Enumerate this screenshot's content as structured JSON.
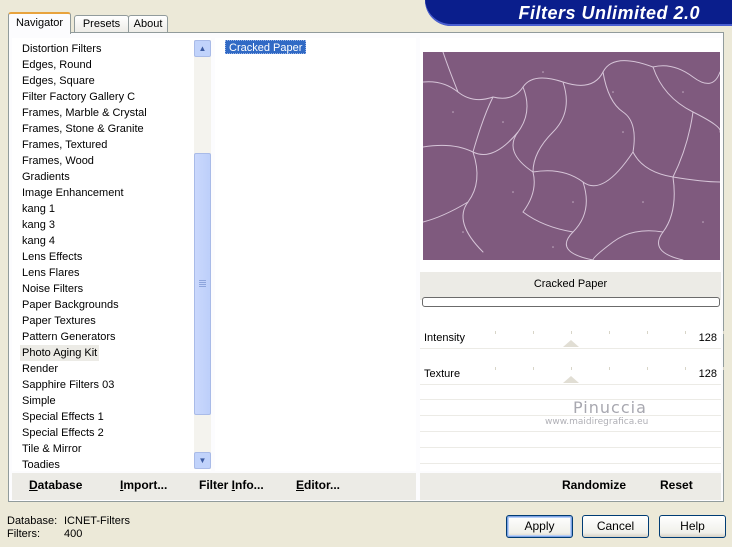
{
  "window": {
    "title": "Filters Unlimited 2.0"
  },
  "tabs": [
    {
      "label": "Navigator",
      "active": true
    },
    {
      "label": "Presets",
      "active": false
    },
    {
      "label": "About",
      "active": false
    }
  ],
  "categories": {
    "items": [
      "Distortion Filters",
      "Edges, Round",
      "Edges, Square",
      "Filter Factory Gallery C",
      "Frames, Marble & Crystal",
      "Frames, Stone & Granite",
      "Frames, Textured",
      "Frames, Wood",
      "Gradients",
      "Image Enhancement",
      "kang 1",
      "kang 3",
      "kang 4",
      "Lens Effects",
      "Lens Flares",
      "Noise Filters",
      "Paper Backgrounds",
      "Paper Textures",
      "Pattern Generators",
      "Photo Aging Kit",
      "Render",
      "Sapphire Filters 03",
      "Simple",
      "Special Effects 1",
      "Special Effects 2",
      "Tile & Mirror",
      "Toadies"
    ],
    "selected": "Photo Aging Kit"
  },
  "filters": {
    "items": [
      "Cracked Paper"
    ],
    "selected": "Cracked Paper"
  },
  "preview": {
    "filter_name": "Cracked Paper",
    "image_color": "#7f5a7e",
    "progress": 0
  },
  "parameters": [
    {
      "label": "Intensity",
      "value": "128",
      "level": 128,
      "max": 255
    },
    {
      "label": "Texture",
      "value": "128",
      "level": 128,
      "max": 255
    }
  ],
  "watermark": {
    "name": "Pinuccia",
    "url": "www.maidiregrafica.eu"
  },
  "toolbar": {
    "database_mnemonic": "D",
    "database_rest": "atabase",
    "import_mnemonic": "I",
    "import_rest": "mport...",
    "filter_info_prefix": "Filter ",
    "filter_info_mnemonic": "I",
    "filter_info_rest": "nfo...",
    "editor_mnemonic": "E",
    "editor_rest": "ditor...",
    "randomize_label": "Randomize",
    "reset_label": "Reset"
  },
  "footer": {
    "database_label": "Database:",
    "database_value": "ICNET-Filters",
    "filters_label": "Filters:",
    "filters_value": "400",
    "apply_label": "Apply",
    "cancel_label": "Cancel",
    "help_label": "Help"
  },
  "colors": {
    "selection": "#316ac5",
    "banner": "#0a1e8c",
    "dialog_face": "#ece9d8"
  }
}
